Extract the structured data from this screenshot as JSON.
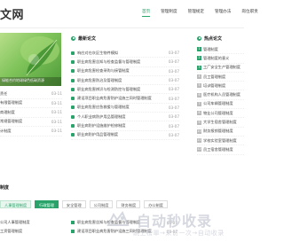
{
  "header": {
    "logo": "文网",
    "nav": [
      "首页",
      "管理制度",
      "管理规定",
      "管理办法",
      "岗位职责"
    ]
  },
  "hero": {
    "caption": "绿能合约地球绿色低碳资源"
  },
  "left_list": [
    {
      "t": "责任",
      "d": "03-11"
    },
    {
      "t": "有限管理制度",
      "d": "03-11"
    },
    {
      "t": "商理制度",
      "d": "03-11"
    },
    {
      "t": "常规管理制度",
      "d": "03-11"
    },
    {
      "t": "计制度",
      "d": "03-11"
    }
  ],
  "latest": {
    "title": "最新论文",
    "items": [
      {
        "t": "响应对在灰区生物件模拟",
        "d": "03-07"
      },
      {
        "t": "职业病危害告知与检查监督与管理制度",
        "d": "03-07"
      },
      {
        "t": "职业病危害检查采购与接管制度",
        "d": "03-07"
      },
      {
        "t": "职业病危害防治及管理制度",
        "d": "03-07"
      },
      {
        "t": "职业病危害辨识与检测防控与管理制度",
        "d": "03-07"
      },
      {
        "t": "建设项目职业病危害防护设施三同时管理制度",
        "d": "03-07"
      },
      {
        "t": "职业病危害应急救援与管理制度",
        "d": "03-07"
      },
      {
        "t": "个人职业病防护用品管理制度",
        "d": "03-07"
      },
      {
        "t": "职业病防护设施维护检修制度",
        "d": "03-07"
      },
      {
        "t": "职业病防护用品管理制度",
        "d": "03-07"
      }
    ]
  },
  "hot": {
    "title": "热点论文",
    "items": [
      "管理制度",
      "管理制度的意义",
      "工厂安全生产管理制度",
      "员工管理制度",
      "培训管理制度",
      "医疗机构人员管理制度",
      "公司车辆管理制度",
      "物业公司管理制度",
      "大学生宿舍管理制度",
      "财务报销管理制度",
      "学校实验室管理制度",
      "员工宿舍管理制度"
    ]
  },
  "bottom": {
    "title": "制度",
    "tabs": [
      "人事管理制度",
      "行政管理",
      "安全管理",
      "公司制度",
      "财务制度",
      "办公制度"
    ],
    "rows": [
      {
        "c1": "公司人事管理制度",
        "c2": "职业病危害告知与检查监督与管理制度",
        "d": "03-07"
      },
      {
        "c1": "工资管理制度",
        "c2": "建设项目职业病危害防护设施三同时管理制度",
        "d": "03-07"
      }
    ]
  },
  "watermark": {
    "text": "自动秒收录",
    "sub": "跳上榜單→来访一次→自动收录"
  },
  "colors": {
    "accent": "#2aa36b"
  }
}
